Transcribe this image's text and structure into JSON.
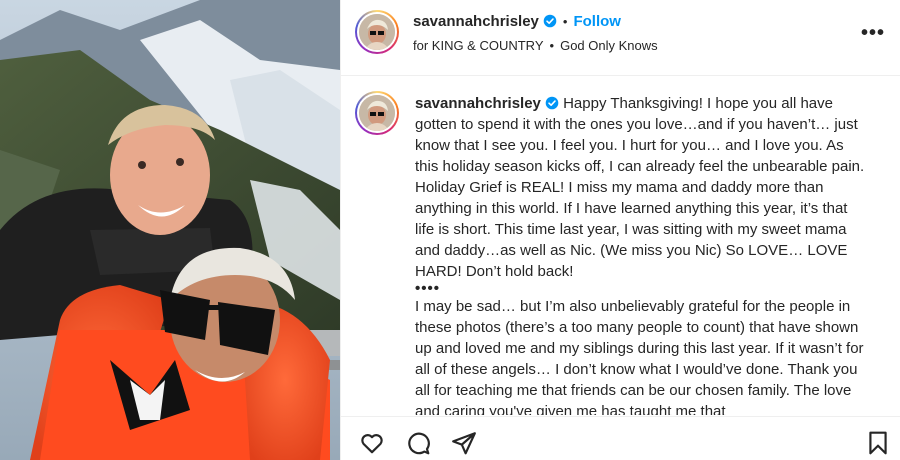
{
  "post": {
    "username": "savannahchrisley",
    "follow_label": "Follow",
    "separator": "•",
    "audio": {
      "artist": "for KING & COUNTRY",
      "separator": "•",
      "song": "God Only Knows"
    },
    "more_label": "•••"
  },
  "caption": {
    "username": "savannahchrisley",
    "paragraph1": "Happy Thanksgiving! I hope you all have gotten to spend it with the ones you love…and if you haven’t… just know that I see you. I feel you. I hurt for you… and I love you. As this holiday season kicks off, I can already feel the unbearable pain. Holiday Grief is REAL! I miss my mama and daddy more than anything in this world. If I have learned anything this year, it’s that life is short. This time last year, I was sitting with my sweet mama and daddy…as well as Nic. (We miss you Nic) So LOVE… LOVE HARD! Don’t hold back!",
    "separator": "••••",
    "paragraph2": "I may be sad… but I’m also unbelievably grateful for the people in these photos (there’s a too many people to count) that have shown up and loved me and my siblings during this last year. If it wasn’t for all of these angels… I don’t know what I would’ve done. Thank you all for teaching me that friends can be our chosen family. The love and caring you've given me has taught me that"
  },
  "icons": {
    "like": "heart-icon",
    "comment": "comment-icon",
    "share": "share-icon",
    "save": "bookmark-icon",
    "verified": "verified-badge-icon"
  },
  "colors": {
    "follow": "#0095f6",
    "verified": "#0095f6",
    "text": "#262626",
    "divider": "#efefef"
  }
}
